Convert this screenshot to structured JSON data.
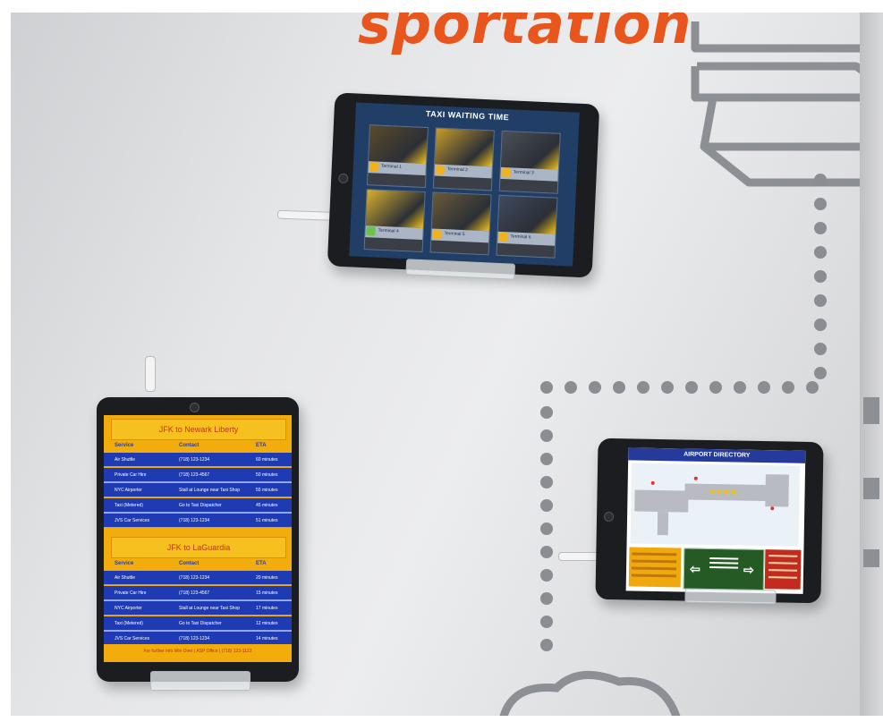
{
  "headline": "sportation",
  "taxi_tablet": {
    "title": "TAXI WAITING TIME",
    "tiles": [
      {
        "label": "Terminal 1",
        "status": "amber",
        "photo": "#5a4a2a"
      },
      {
        "label": "Terminal 2",
        "status": "amber",
        "photo": "#c89b2a"
      },
      {
        "label": "Terminal 3",
        "status": "amber",
        "photo": "#4b4f56"
      },
      {
        "label": "Terminal 4",
        "status": "green",
        "photo": "#d8b12e"
      },
      {
        "label": "Terminal 5",
        "status": "amber",
        "photo": "#6a5a3a"
      },
      {
        "label": "Terminal 6",
        "status": "amber",
        "photo": "#3e4a5e"
      }
    ]
  },
  "schedule_tablet": {
    "section1_title": "JFK to Newark Liberty",
    "section2_title": "JFK to LaGuardia",
    "headers": [
      "Service",
      "Contact",
      "ETA"
    ],
    "section1_rows": [
      [
        "Air Shuttle",
        "(718) 123-1234",
        "60 minutes"
      ],
      [
        "Private Car Hire",
        "(718) 123-4567",
        "50 minutes"
      ],
      [
        "NYC Airporter",
        "Stall at Lounge near Taxi Shop",
        "55 minutes"
      ],
      [
        "Taxi (Metered)",
        "Go to Taxi Dispatcher",
        "45 minutes"
      ],
      [
        "JVS Car Services",
        "(718) 123-1234",
        "51 minutes"
      ]
    ],
    "section2_rows": [
      [
        "Air Shuttle",
        "(718) 123-1234",
        "20 minutes"
      ],
      [
        "Private Car Hire",
        "(718) 123-4567",
        "15 minutes"
      ],
      [
        "NYC Airporter",
        "Stall at Lounge near Taxi Shop",
        "17 minutes"
      ],
      [
        "Taxi (Metered)",
        "Go to Taxi Dispatcher",
        "12 minutes"
      ],
      [
        "JVS Car Services",
        "(718) 123-1234",
        "14 minutes"
      ]
    ],
    "footer": "For further info Win Over | ASP Office | (718) 123-1122"
  },
  "directory_tablet": {
    "title": "AIRPORT DIRECTORY"
  },
  "colors": {
    "accent_orange": "#e8561e",
    "dot_grey": "#8a8d91",
    "schedule_blue": "#1f3bb3",
    "schedule_amber": "#f2ad0c",
    "directory_green": "#265a24",
    "directory_red": "#c42b1c"
  }
}
